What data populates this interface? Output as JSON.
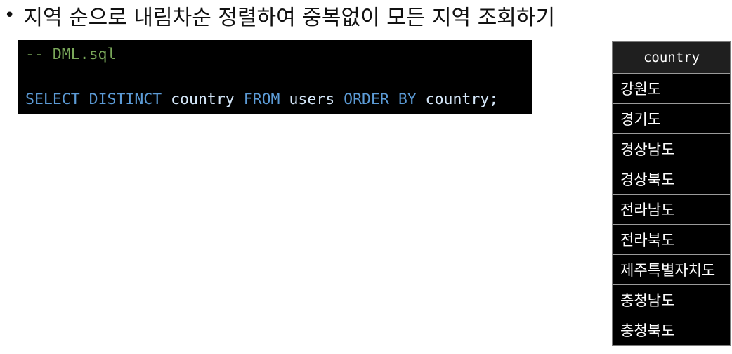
{
  "heading": {
    "bullet": "•",
    "text": "지역 순으로 내림차순 정렬하여 중복없이 모든 지역 조회하기"
  },
  "code": {
    "comment": "-- DML.sql",
    "tokens": {
      "select": "SELECT",
      "distinct": "DISTINCT",
      "col1": "country",
      "from": "FROM",
      "table": "users",
      "order": "ORDER",
      "by": "BY",
      "col2": "country",
      "end": ";"
    }
  },
  "result": {
    "header": "country",
    "rows": [
      "강원도",
      "경기도",
      "경상남도",
      "경상북도",
      "전라남도",
      "전라북도",
      "제주특별자치도",
      "충청남도",
      "충청북도"
    ]
  }
}
